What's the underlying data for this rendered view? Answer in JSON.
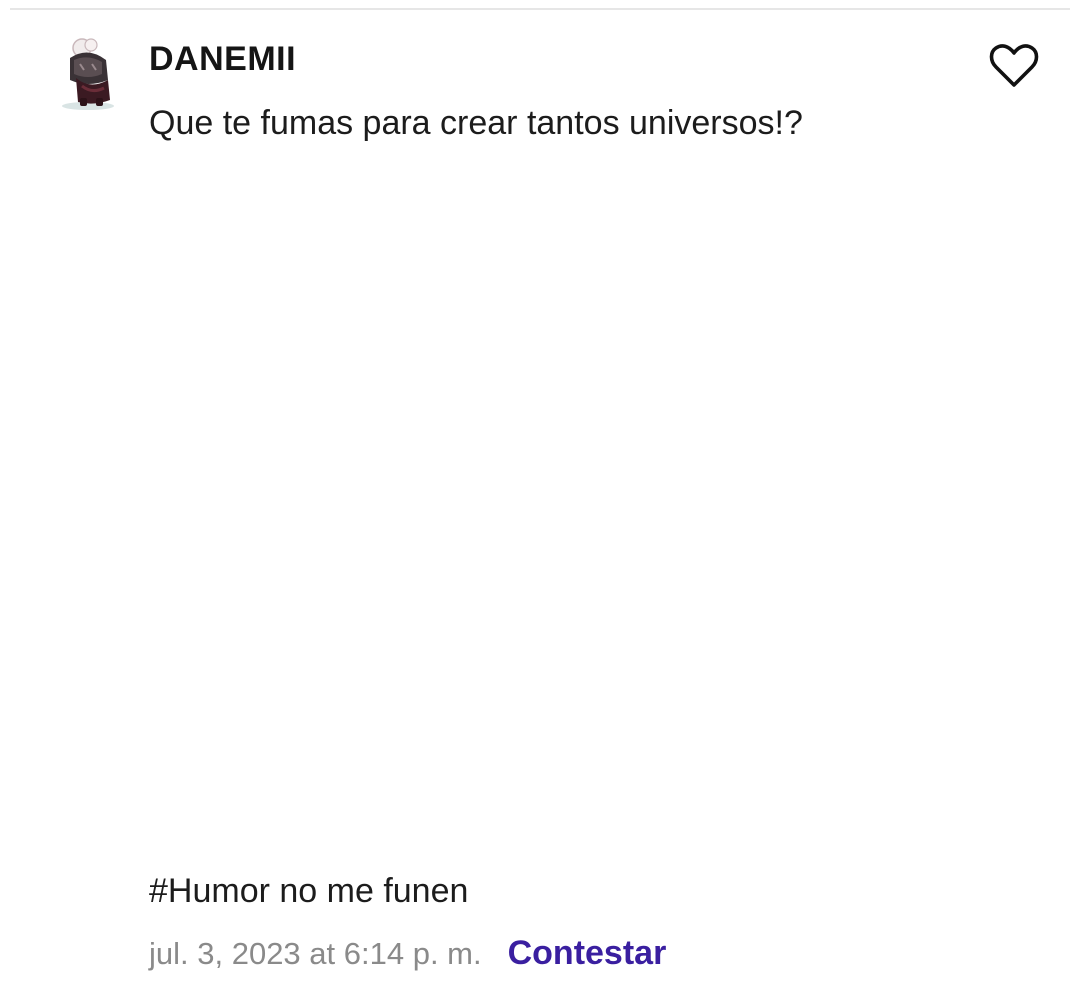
{
  "comment": {
    "username": "DANEMII",
    "text": "Que te fumas para crear tantos universos!?",
    "hashtag_line": "#Humor no me funen",
    "timestamp": "jul. 3, 2023 at 6:14 p. m.",
    "reply_label": "Contestar",
    "avatar_icon": "character-avatar",
    "like_icon": "heart-outline-icon"
  },
  "colors": {
    "reply_accent": "#3a1fa0",
    "timestamp_gray": "#8a8a8a"
  }
}
